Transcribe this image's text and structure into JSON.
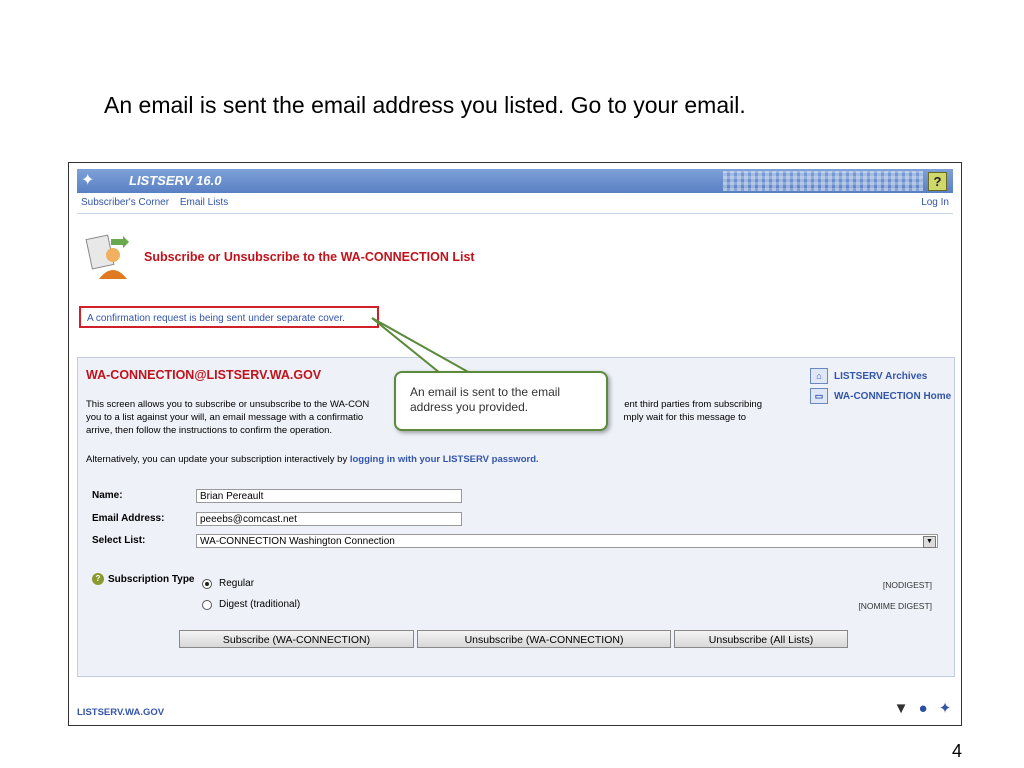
{
  "slide": {
    "title": "An email is sent the email address you listed.  Go to your email.",
    "page_number": "4"
  },
  "app": {
    "product": "LISTSERV 16.0",
    "help_label": "?",
    "nav_left": [
      "Subscriber's Corner",
      "Email Lists"
    ],
    "nav_right": "Log In"
  },
  "header": {
    "title": "Subscribe or Unsubscribe to the WA-CONNECTION List"
  },
  "confirmation": "A confirmation request is being sent under separate cover.",
  "panel": {
    "list_address": "WA-CONNECTION@LISTSERV.WA.GOV",
    "description_line1_left": "This screen allows you to subscribe or unsubscribe to the WA-CON",
    "description_line1_right": "ent third parties from subscribing",
    "description_line2_left": "you to a list against your will, an email message with a confirmatio",
    "description_line2_right": "mply wait for this message to",
    "description_line3": "arrive, then follow the instructions to confirm the operation.",
    "alt_prefix": "Alternatively, you can update your subscription interactively by ",
    "alt_link": "logging in with your LISTSERV password.",
    "links": [
      "LISTSERV Archives",
      "WA-CONNECTION Home"
    ]
  },
  "form": {
    "name_label": "Name:",
    "name_value": "Brian Pereault",
    "email_label": "Email Address:",
    "email_value": "peeebs@comcast.net",
    "list_label": "Select List:",
    "list_value": "WA-CONNECTION Washington Connection",
    "subscription_type_label": "Subscription Type",
    "options": [
      {
        "label": "Regular",
        "code": "[NODIGEST]",
        "selected": true
      },
      {
        "label": "Digest (traditional)",
        "code": "[NOMIME DIGEST]",
        "selected": false
      }
    ],
    "buttons": [
      "Subscribe (WA-CONNECTION)",
      "Unsubscribe (WA-CONNECTION)",
      "Unsubscribe (All Lists)"
    ]
  },
  "footer": {
    "site": "LISTSERV.WA.GOV"
  },
  "callout": {
    "text": "An email is sent to the email address you provided."
  },
  "colors": {
    "accent_red": "#c1121b",
    "link_blue": "#3355aa",
    "callout_border": "#5a8a3a"
  }
}
